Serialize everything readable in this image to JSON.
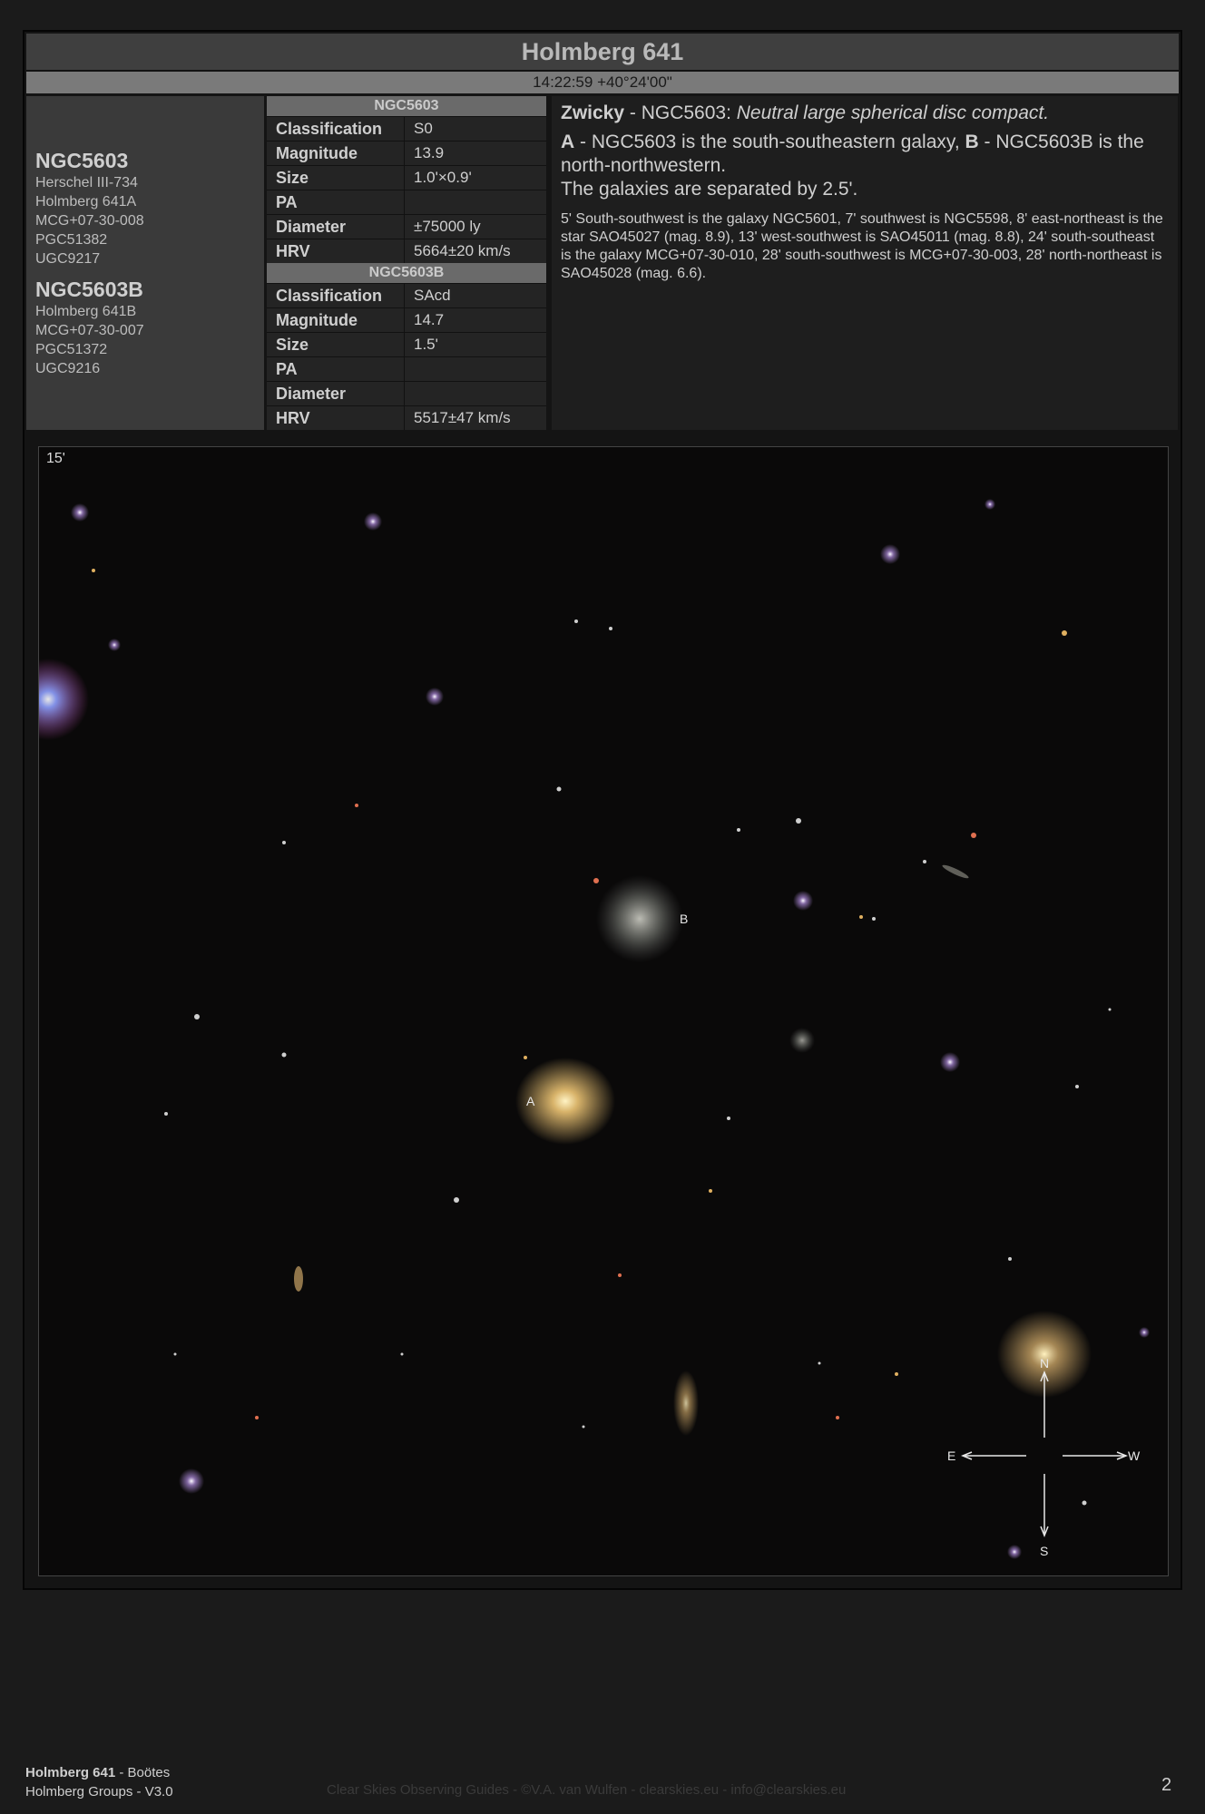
{
  "header": {
    "title": "Holmberg 641",
    "coords": "14:22:59 +40°24'00\""
  },
  "objects": [
    {
      "name": "NGC5603",
      "aliases": [
        "Herschel III-734",
        "Holmberg 641A",
        "MCG+07-30-008",
        "PGC51382",
        "UGC9217"
      ]
    },
    {
      "name": "NGC5603B",
      "aliases": [
        "Holmberg 641B",
        "MCG+07-30-007",
        "PGC51372",
        "UGC9216"
      ]
    }
  ],
  "tables": [
    {
      "title": "NGC5603",
      "rows": [
        {
          "k": "Classification",
          "v": "S0"
        },
        {
          "k": "Magnitude",
          "v": "13.9"
        },
        {
          "k": "Size",
          "v": "1.0'×0.9'"
        },
        {
          "k": "PA",
          "v": ""
        },
        {
          "k": "Diameter",
          "v": "±75000 ly"
        },
        {
          "k": "HRV",
          "v": "5664±20 km/s"
        }
      ]
    },
    {
      "title": "NGC5603B",
      "rows": [
        {
          "k": "Classification",
          "v": "SAcd"
        },
        {
          "k": "Magnitude",
          "v": "14.7"
        },
        {
          "k": "Size",
          "v": "1.5'"
        },
        {
          "k": "PA",
          "v": ""
        },
        {
          "k": "Diameter",
          "v": ""
        },
        {
          "k": "HRV",
          "v": "5517±47 km/s"
        }
      ]
    }
  ],
  "description": {
    "zwicky_label": "Zwicky",
    "zwicky_obj": " - NGC5603: ",
    "zwicky_text": "Neutral large spherical disc compact.",
    "a_label": "A",
    "a_text": " - NGC5603 is the south-southeastern galaxy, ",
    "b_label": "B",
    "b_text": " - NGC5603B is the north-northwestern.",
    "separation": "The galaxies are separated by 2.5'.",
    "neighbourhood": "5' South-southwest is the galaxy NGC5601, 7' southwest is NGC5598, 8' east-northeast is the star SAO45027 (mag. 8.9), 13' west-southwest is SAO45011 (mag. 8.8), 24' south-southeast is the galaxy MCG+07-30-010, 28' south-southwest is MCG+07-30-003, 28' north-northeast is SAO45028 (mag. 6.6)."
  },
  "image": {
    "scale": "15'",
    "label_a": "A",
    "label_b": "B",
    "compass": {
      "n": "N",
      "e": "E",
      "w": "W",
      "s": "S"
    }
  },
  "footer": {
    "object": "Holmberg 641",
    "constellation": " - Boötes",
    "series": "Holmberg Groups - V3.0",
    "credit": "Clear Skies Observing Guides - ©V.A. van Wulfen - clearskies.eu - info@clearskies.eu",
    "page": "2"
  }
}
